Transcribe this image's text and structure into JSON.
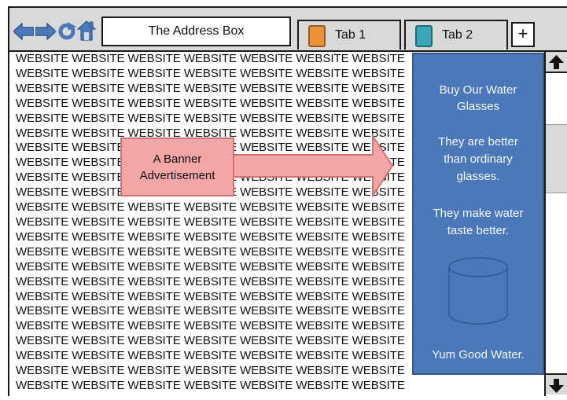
{
  "browser": {
    "address_box": "The Address Box",
    "tabs": [
      {
        "label": "Tab 1",
        "icon": "orange-tab-icon",
        "icon_color": "#e8923a"
      },
      {
        "label": "Tab 2",
        "icon": "teal-tab-icon",
        "icon_color": "#3aa7b8"
      }
    ],
    "new_tab_label": "+",
    "nav_icons": [
      "back-arrow-icon",
      "forward-arrow-icon",
      "refresh-icon",
      "home-icon"
    ],
    "nav_color": "#4a78b8"
  },
  "content": {
    "lines": [
      "WEBSITE WEBSITE WEBSITE WEBSITE WEBSITE WEBSITE WEBSITE",
      "WEBSITE WEBSITE WEBSITE WEBSITE WEBSITE WEBSITE WEBSITE",
      "WEBSITE WEBSITE WEBSITE WEBSITE WEBSITE WEBSITE WEBSITE",
      "WEBSITE WEBSITE WEBSITE WEBSITE WEBSITE WEBSITE WEBSITE",
      "WEBSITE WEBSITE WEBSITE WEBSITE WEBSITE WEBSITE WEBSITE",
      "WEBSITE WEBSITE WEBSITE WEBSITE WEBSITE WEBSITE WEBSITE",
      "WEBSITE WEBSITE WEBSITE WEBSITE WEBSITE WEBSITE WEBSITE",
      "WEBSITE WEBSITE WEBSITE WEBSITE WEBSITE WEBSITE WEBSITE",
      "WEBSITE WEBSITE WEBSITE WEBSITE WEBSITE WEBSITE WEBSITE",
      "WEBSITE WEBSITE WEBSITE WEBSITE WEBSITE WEBSITE WEBSITE",
      "WEBSITE WEBSITE WEBSITE WEBSITE WEBSITE WEBSITE WEBSITE",
      "WEBSITE WEBSITE WEBSITE WEBSITE WEBSITE WEBSITE WEBSITE",
      "WEBSITE WEBSITE WEBSITE WEBSITE WEBSITE WEBSITE WEBSITE",
      "WEBSITE WEBSITE WEBSITE WEBSITE WEBSITE WEBSITE WEBSITE",
      "WEBSITE WEBSITE WEBSITE WEBSITE WEBSITE WEBSITE WEBSITE",
      "WEBSITE WEBSITE WEBSITE WEBSITE WEBSITE WEBSITE WEBSITE",
      "WEBSITE WEBSITE WEBSITE WEBSITE WEBSITE WEBSITE WEBSITE",
      "WEBSITE WEBSITE WEBSITE WEBSITE WEBSITE WEBSITE WEBSITE",
      "WEBSITE WEBSITE WEBSITE WEBSITE WEBSITE WEBSITE WEBSITE",
      "WEBSITE WEBSITE WEBSITE WEBSITE WEBSITE WEBSITE WEBSITE",
      "WEBSITE WEBSITE WEBSITE WEBSITE WEBSITE WEBSITE WEBSITE",
      "WEBSITE WEBSITE WEBSITE WEBSITE WEBSITE WEBSITE WEBSITE",
      "WEBSITE WEBSITE WEBSITE WEBSITE WEBSITE WEBSITE WEBSITE"
    ]
  },
  "banner": {
    "line1": "A Banner",
    "line2": "Advertisement",
    "color": "#f4a6a6",
    "arrow_icon": "right-arrow-icon"
  },
  "side_ad": {
    "heading_line1": "Buy Our Water",
    "heading_line2": "Glasses",
    "p2_line1": "They are better",
    "p2_line2": "than ordinary",
    "p2_line3": "glasses.",
    "p3_line1": "They make water",
    "p3_line2": "taste better.",
    "image_icon": "water-glass-icon",
    "footer": "Yum Good Water.",
    "background": "#4a78b8"
  },
  "scrollbar": {
    "up_icon": "up-arrow-icon",
    "down_icon": "down-arrow-icon"
  }
}
